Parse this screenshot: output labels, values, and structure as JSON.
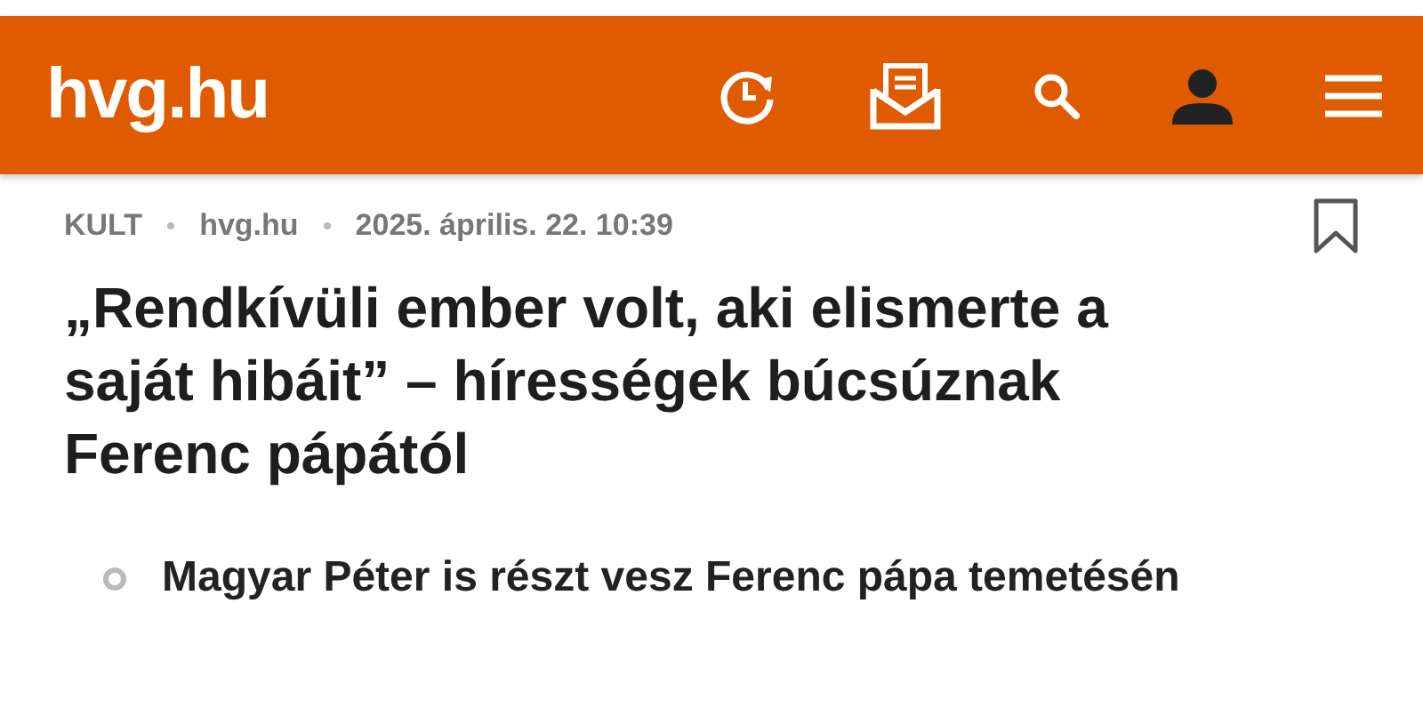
{
  "header": {
    "logo": "hvg.hu"
  },
  "meta": {
    "section": "KULT",
    "source": "hvg.hu",
    "date": "2025. április. 22. 10:39",
    "bookmarked": false
  },
  "headline": "„Rendkívüli ember volt, aki elismerte a saját hibáit” – hírességek búcsúznak Ferenc pápától",
  "related": [
    "Magyar Péter is részt vesz Ferenc pápa temetésén"
  ]
}
